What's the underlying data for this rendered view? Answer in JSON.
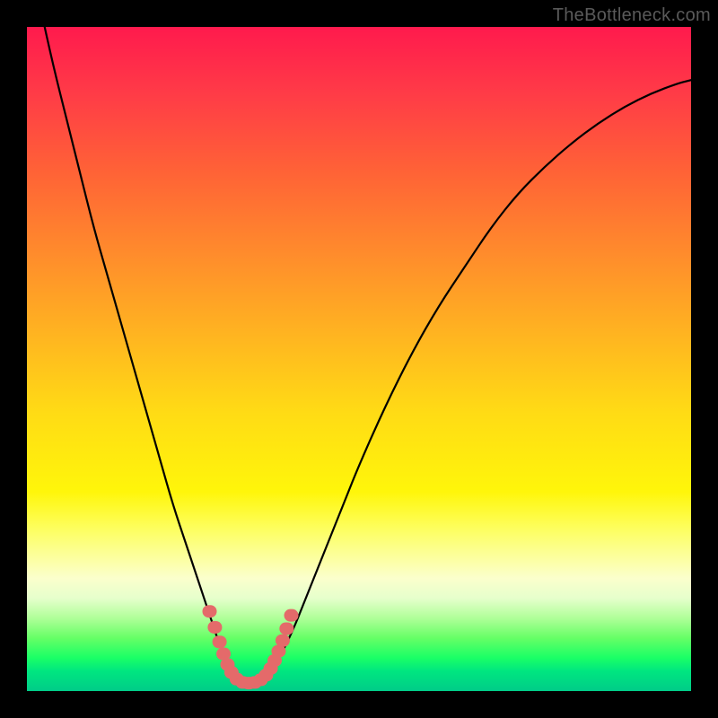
{
  "watermark": "TheBottleneck.com",
  "colors": {
    "frame": "#000000",
    "curve": "#000000",
    "marker_fill": "#e46a6a",
    "marker_stroke": "#cc4e4e"
  },
  "chart_data": {
    "type": "line",
    "title": "",
    "xlabel": "",
    "ylabel": "",
    "xlim": [
      0,
      100
    ],
    "ylim": [
      0,
      100
    ],
    "grid": false,
    "description": "V-shaped bottleneck curve on vertical performance gradient (red=high bottleneck, green=low). Minimum around x≈33.",
    "series": [
      {
        "name": "bottleneck-curve",
        "x": [
          0,
          2,
          4,
          6,
          8,
          10,
          12,
          14,
          16,
          18,
          20,
          22,
          24,
          26,
          28,
          29,
          30,
          31,
          32,
          33,
          34,
          35,
          36,
          37,
          38,
          40,
          42,
          44,
          46,
          48,
          50,
          54,
          58,
          62,
          66,
          70,
          74,
          78,
          82,
          86,
          90,
          94,
          98,
          100
        ],
        "values": [
          112,
          103,
          94,
          86,
          78,
          70,
          63,
          56,
          49,
          42,
          35,
          28,
          22,
          16,
          10,
          7,
          5,
          3,
          1.8,
          1.2,
          1.2,
          1.6,
          2.2,
          3.2,
          5,
          9,
          14,
          19,
          24,
          29,
          34,
          43,
          51,
          58,
          64,
          70,
          75,
          79,
          82.5,
          85.5,
          88,
          90,
          91.5,
          92
        ]
      }
    ],
    "markers": [
      {
        "x": 27.5,
        "y": 12
      },
      {
        "x": 28.3,
        "y": 9.6
      },
      {
        "x": 29.0,
        "y": 7.4
      },
      {
        "x": 29.6,
        "y": 5.6
      },
      {
        "x": 30.2,
        "y": 4.0
      },
      {
        "x": 30.8,
        "y": 2.8
      },
      {
        "x": 31.6,
        "y": 1.8
      },
      {
        "x": 32.5,
        "y": 1.3
      },
      {
        "x": 33.4,
        "y": 1.2
      },
      {
        "x": 34.3,
        "y": 1.3
      },
      {
        "x": 35.2,
        "y": 1.7
      },
      {
        "x": 36.0,
        "y": 2.4
      },
      {
        "x": 36.7,
        "y": 3.4
      },
      {
        "x": 37.3,
        "y": 4.6
      },
      {
        "x": 37.9,
        "y": 6.0
      },
      {
        "x": 38.5,
        "y": 7.6
      },
      {
        "x": 39.1,
        "y": 9.4
      },
      {
        "x": 39.8,
        "y": 11.4
      }
    ]
  }
}
